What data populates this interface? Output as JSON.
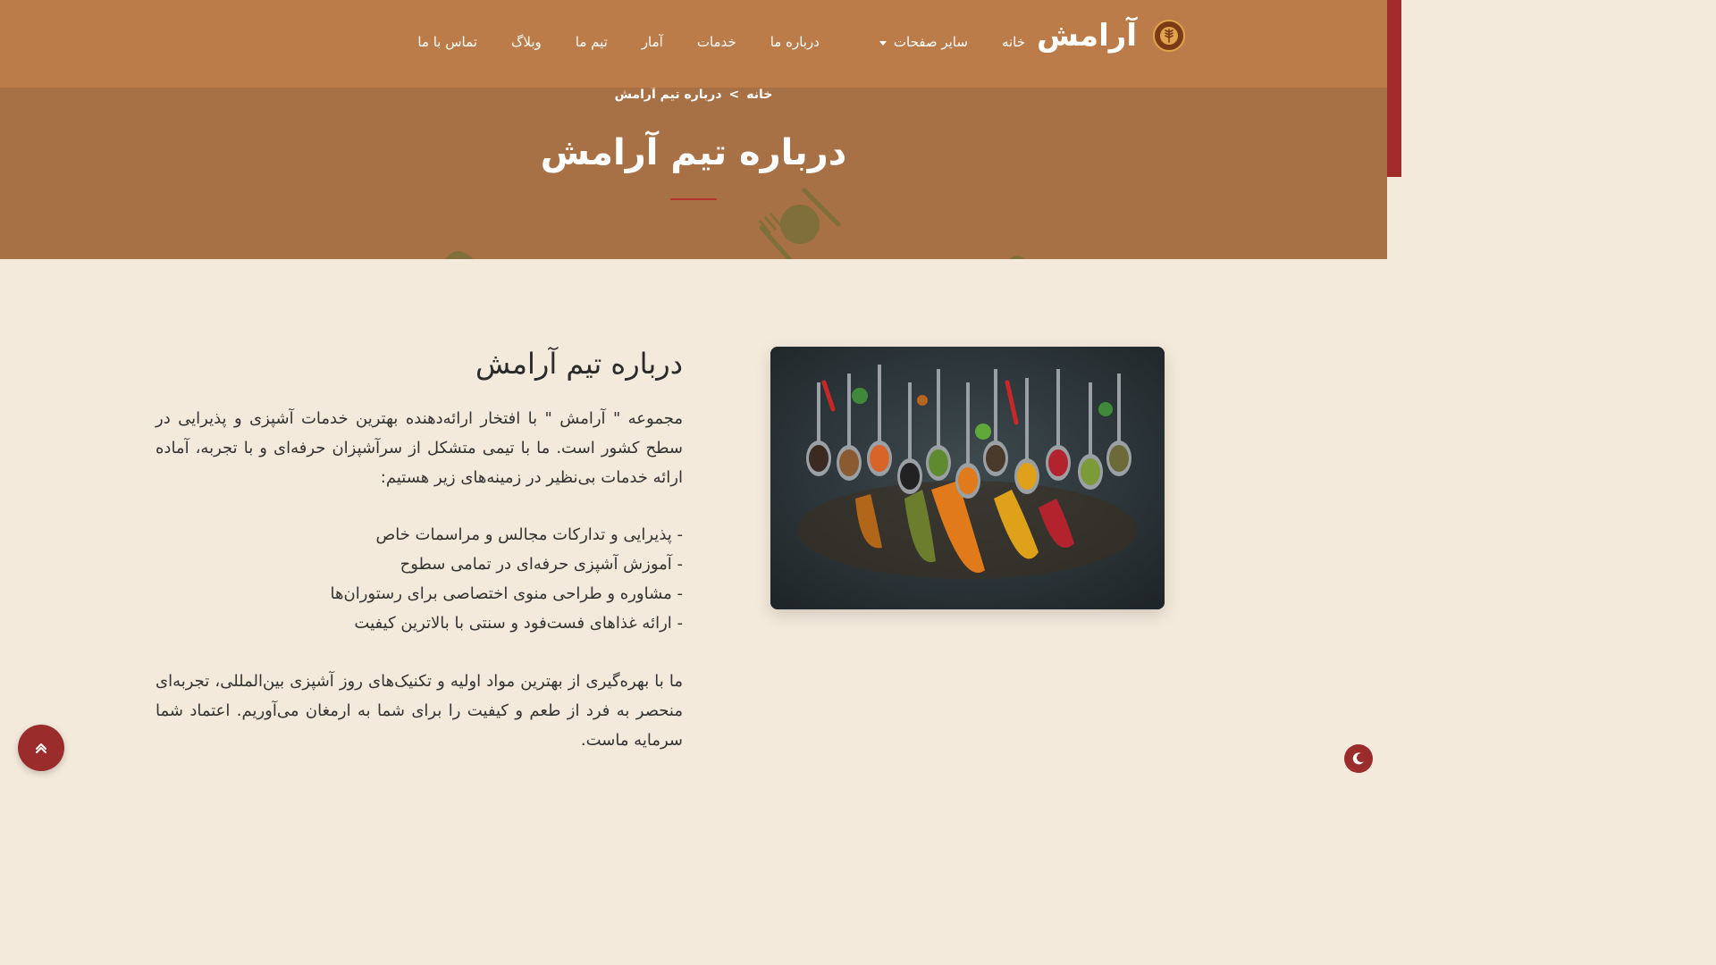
{
  "brand": {
    "name": "آرامش",
    "logo": "wheat-logo-icon"
  },
  "nav": {
    "items": [
      {
        "label": "خانه"
      },
      {
        "label": "سایر صفحات",
        "dropdown": true
      },
      {
        "label": "درباره ما"
      },
      {
        "label": "خدمات"
      },
      {
        "label": "آمار"
      },
      {
        "label": "تیم ما"
      },
      {
        "label": "وبلاگ"
      },
      {
        "label": "تماس با ما"
      }
    ]
  },
  "hero": {
    "breadcrumb": {
      "home": "خانه",
      "separator": ">",
      "current": "درباره تیم آرامش"
    },
    "title": "درباره تیم آرامش"
  },
  "about": {
    "title": "درباره تیم آرامش",
    "intro": "مجموعه \" آرامش \" با افتخار ارائه‌دهنده بهترین خدمات آشپزی و پذیرایی در سطح کشور است. ما با تیمی متشکل از سرآشپزان حرفه‌ای و با تجربه، آماده ارائه خدمات بی‌نظیر در زمینه‌های زیر هستیم:",
    "features": [
      "- پذیرایی و تدارکات مجالس و مراسمات خاص",
      "- آموزش آشپزی حرفه‌ای در تمامی سطوح",
      "- مشاوره و طراحی منوی اختصاصی برای رستوران‌ها",
      "- ارائه غذاهای فست‌فود و سنتی با بالاترین کیفیت"
    ],
    "closing": "ما با بهره‌گیری از بهترین مواد اولیه و تکنیک‌های روز آشپزی بین‌المللی، تجربه‌ای منحصر به فرد از طعم و کیفیت را برای شما به ارمغان می‌آوریم. اعتماد شما سرمایه ماست.",
    "image_icon": "spices-image"
  },
  "controls": {
    "back_to_top_icon": "double-chevron-up-icon",
    "theme_toggle_icon": "moon-icon"
  },
  "colors": {
    "navbar": "#bc7c49",
    "hero": "#a87045",
    "page_bg": "#f4eadc",
    "accent": "#9b2c2c"
  }
}
